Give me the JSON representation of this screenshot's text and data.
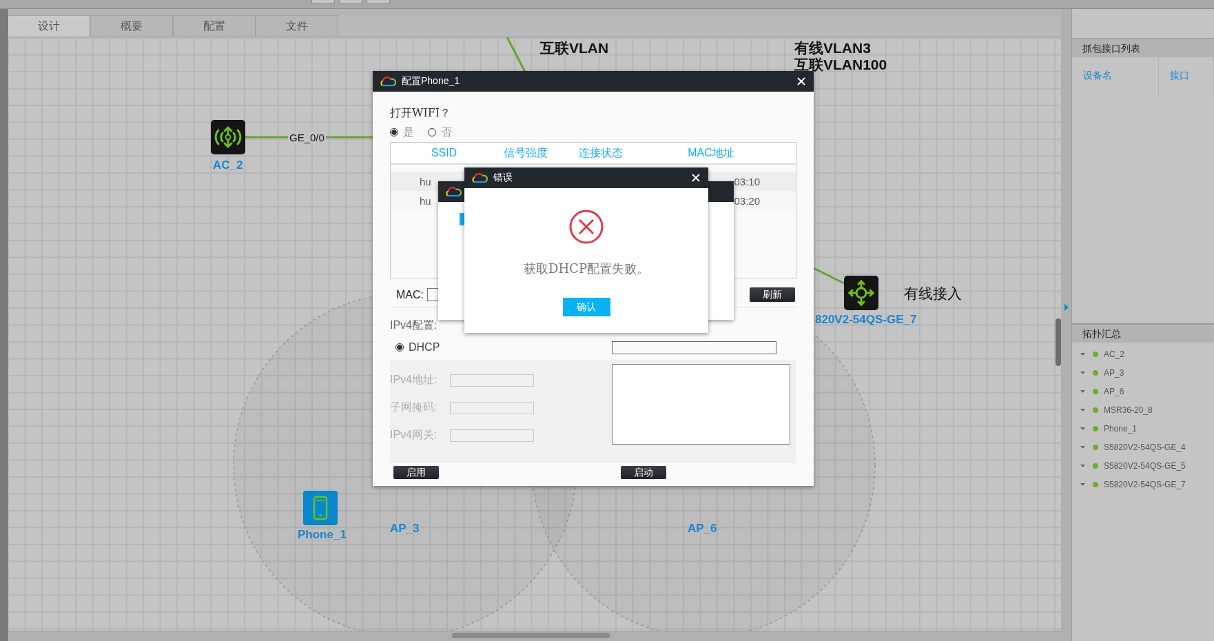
{
  "tabs": [
    {
      "label": "设计",
      "selected": true
    },
    {
      "label": "概要",
      "selected": false
    },
    {
      "label": "配置",
      "selected": false
    },
    {
      "label": "文件",
      "selected": false
    }
  ],
  "canvas": {
    "link_label": "GE_0/0",
    "notes": [
      "互联VLAN",
      "有线VLAN3",
      "互联VLAN100",
      "有线接入"
    ],
    "devices": [
      {
        "kind": "ac",
        "label": "AC_2"
      },
      {
        "kind": "switch",
        "label": "820V2-54QS-GE_7"
      },
      {
        "kind": "phone",
        "label": "Phone_1"
      },
      {
        "kind": "ap",
        "label": "AP_3"
      },
      {
        "kind": "ap",
        "label": "AP_6"
      }
    ]
  },
  "config_dialog": {
    "title": "配置Phone_1",
    "wifi_question": "打开WIFI？",
    "wifi_options": [
      {
        "label": "是",
        "selected": true
      },
      {
        "label": "否",
        "selected": false
      }
    ],
    "columns": [
      "SSID",
      "信号强度",
      "连接状态",
      "MAC地址"
    ],
    "rows": [
      {
        "ssid": "hu",
        "mac": "03:10"
      },
      {
        "ssid": "hu",
        "mac": "03:20"
      }
    ],
    "mac_label": "MAC:",
    "refresh": "刷新",
    "ipv4_title": "IPv4配置:",
    "dhcp": {
      "label": "DHCP",
      "selected": true
    },
    "fields": [
      {
        "label": "IPv4地址:",
        "disabled": true
      },
      {
        "label": "子网掩码:",
        "disabled": true
      },
      {
        "label": "IPv4网关:",
        "disabled": true
      }
    ],
    "apply": "启用",
    "start": "启动"
  },
  "error_dialog": {
    "title": "错误",
    "message": "获取DHCP配置失败。",
    "confirm": "确认"
  },
  "capture_panel": {
    "title": "抓包接口列表",
    "columns": [
      "设备名",
      "接口"
    ]
  },
  "topology": {
    "title": "拓扑汇总",
    "items": [
      "AC_2",
      "AP_3",
      "AP_6",
      "MSR36-20_8",
      "Phone_1",
      "S5820V2-54QS-GE_4",
      "S5820V2-54QS-GE_5",
      "S5820V2-54QS-GE_7"
    ]
  }
}
